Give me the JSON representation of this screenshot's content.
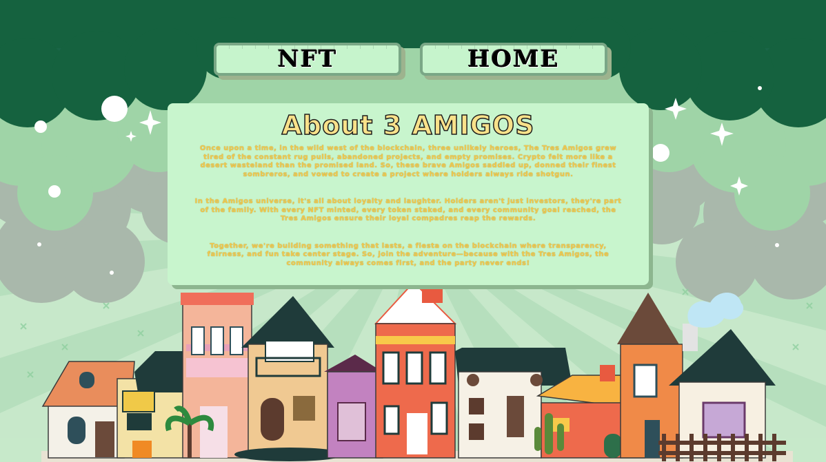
{
  "nav": {
    "nft_label": "NFT",
    "home_label": "HOME"
  },
  "about": {
    "title": "About 3 AMIGOS",
    "paragraphs": [
      "Once upon a time, in the wild west of the blockchain, three unlikely heroes, The Tres Amigos grew tired of the constant rug pulls, abandoned projects, and empty promises. Crypto felt more like a desert wasteland than the promised land. So, these brave Amigos saddled up, donned their finest sombreros, and vowed to create a project where holders always ride shotgun.",
      "In the Amigos universe, it's all about loyalty and laughter. Holders aren't just investors, they're part of the family. With every NFT minted, every token staked, and every community goal reached, the Tres Amigos ensure their loyal compadres reap the rewards.",
      "Together, we're building something that lasts, a fiesta on the blockchain where transparency, fairness, and fun take center stage. So, join the adventure—because with the Tres Amigos, the community always comes first, and the party never ends!"
    ]
  },
  "colors": {
    "dark_green": "#1a6648",
    "mint_panel": "#c8f5cd",
    "text_gold": "#f2c94c",
    "title_cream": "#f8e18a"
  }
}
